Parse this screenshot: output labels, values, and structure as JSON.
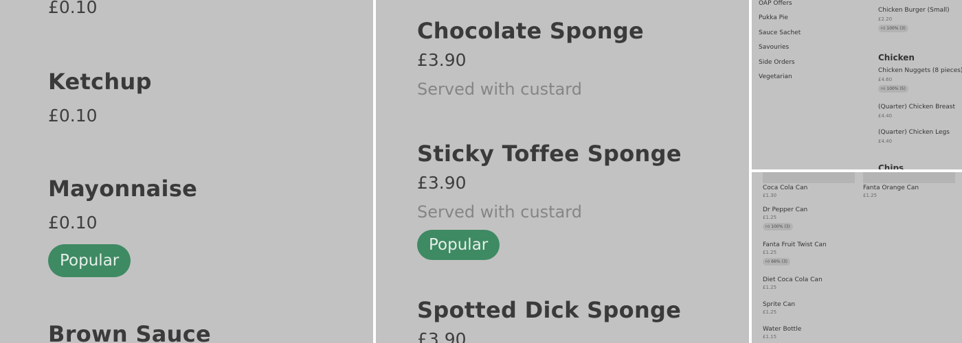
{
  "panel1": {
    "top_price": "£0.10",
    "items": [
      {
        "name": "Ketchup",
        "price": "£0.10"
      },
      {
        "name": "Mayonnaise",
        "price": "£0.10",
        "badge": "Popular"
      },
      {
        "name": "Brown Sauce"
      }
    ]
  },
  "panel2": {
    "items": [
      {
        "name": "Chocolate Sponge",
        "price": "£3.90",
        "desc": "Served with custard"
      },
      {
        "name": "Sticky Toffee Sponge",
        "price": "£3.90",
        "desc": "Served with custard",
        "badge": "Popular"
      },
      {
        "name": "Spotted Dick Sponge",
        "price": "£3.90"
      }
    ]
  },
  "panel3": {
    "categories": [
      "OAP Offers",
      "Pukka Pie",
      "Sauce Sachet",
      "Savouries",
      "Side Orders",
      "Vegetarian"
    ],
    "items": [
      {
        "name": "Chicken Burger (Small)",
        "price": "£2.20",
        "rating": "100% (3)"
      }
    ],
    "section_heading": "Chicken",
    "section_items": [
      {
        "name": "Chicken Nuggets (8 pieces)",
        "price": "£4.60",
        "rating": "100% (5)"
      },
      {
        "name": "(Quarter) Chicken Breast",
        "price": "£4.40"
      },
      {
        "name": "(Quarter) Chicken Legs",
        "price": "£4.40"
      }
    ],
    "next_heading": "Chips"
  },
  "panel4": {
    "left_items": [
      {
        "name": "Coca Cola Can",
        "price": "£1.30"
      },
      {
        "name": "Dr Pepper Can",
        "price": "£1.25",
        "rating": "100% (3)"
      },
      {
        "name": "Fanta Fruit Twist Can",
        "price": "£1.25",
        "rating": "66% (3)"
      },
      {
        "name": "Diet Coca Cola Can",
        "price": "£1.25"
      },
      {
        "name": "Sprite Can",
        "price": "£1.25"
      },
      {
        "name": "Water Bottle",
        "price": "£1.15"
      }
    ],
    "right_items": [
      {
        "name": "Fanta Orange Can",
        "price": "£1.25"
      }
    ]
  },
  "icons": {
    "rating": "thumbs-up-icon"
  },
  "colors": {
    "background": "#c2c2c2",
    "popular_badge": "#3e8a63"
  }
}
